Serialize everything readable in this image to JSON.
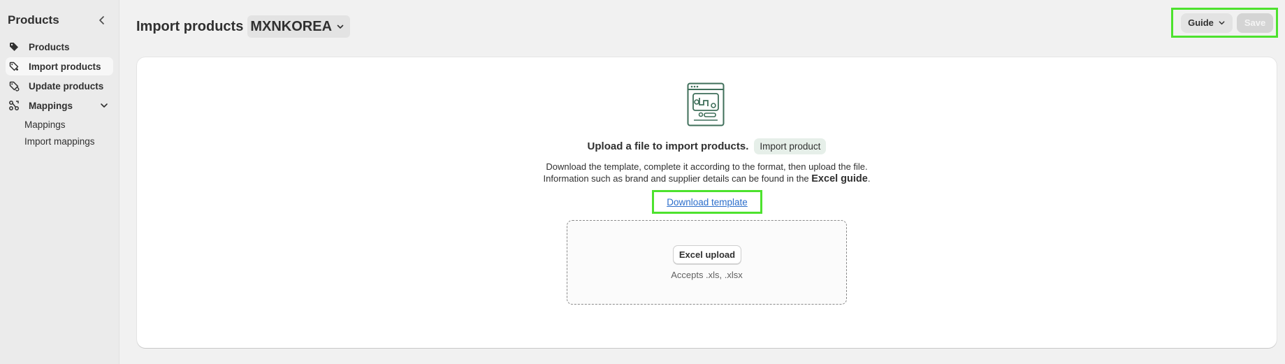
{
  "sidebar": {
    "title": "Products",
    "items": [
      {
        "label": "Products",
        "icon": "tag-icon"
      },
      {
        "label": "Import products",
        "icon": "import-tag-icon",
        "active": true
      },
      {
        "label": "Update products",
        "icon": "update-tag-icon"
      },
      {
        "label": "Mappings",
        "icon": "mapping-icon",
        "expanded": true
      }
    ],
    "subitems": [
      {
        "label": "Mappings"
      },
      {
        "label": "Import mappings"
      }
    ]
  },
  "header": {
    "title": "Import products",
    "store": "MXNKOREA",
    "guide_label": "Guide",
    "save_label": "Save"
  },
  "main": {
    "upload_heading": "Upload a file to import products.",
    "badge": "Import product",
    "desc_line1": "Download the template, complete it according to the format, then upload the file.",
    "desc_line2_prefix": "Information such as brand and supplier details can be found in the",
    "desc_line2_link": "Excel guide",
    "desc_line2_suffix": ".",
    "download_label": "Download template",
    "excel_upload_label": "Excel upload",
    "accepts_text": "Accepts .xls, .xlsx"
  },
  "colors": {
    "accent_highlight": "#4de22e",
    "link": "#2c6ecb",
    "icon_green": "#3f6f5a"
  }
}
